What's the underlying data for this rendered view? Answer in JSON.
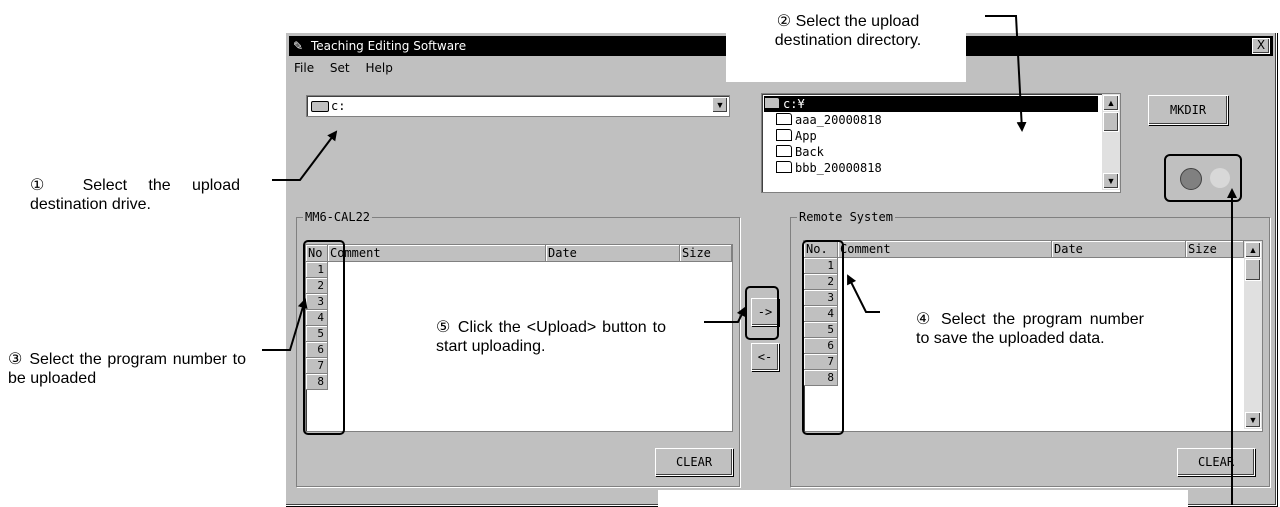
{
  "window": {
    "title": "Teaching Editing Software",
    "close_glyph": "X",
    "menu": [
      "File",
      "Set",
      "Help"
    ]
  },
  "drive": {
    "value": "c:"
  },
  "directory": {
    "items": [
      "c:¥",
      "aaa_20000818",
      "App",
      "Back",
      "bbb_20000818"
    ]
  },
  "buttons": {
    "mkdir": "MKDIR",
    "upload": "->",
    "download": "<-",
    "clear_left": "CLEAR",
    "clear_right": "CLEAR"
  },
  "left_panel": {
    "group_label": "MM6-CAL22",
    "columns": [
      "No",
      "Comment",
      "Date",
      "Size"
    ],
    "rows": [
      "1",
      "2",
      "3",
      "4",
      "5",
      "6",
      "7",
      "8"
    ]
  },
  "right_panel": {
    "group_label": "Remote System",
    "columns": [
      "No.",
      "Comment",
      "Date",
      "Size"
    ],
    "rows": [
      "1",
      "2",
      "3",
      "4",
      "5",
      "6",
      "7",
      "8"
    ]
  },
  "annotations": {
    "a1_mark": "①",
    "a1_text": "Select the upload destination drive.",
    "a2_mark": "②",
    "a2_text": "Select the upload destination directory.",
    "a3_mark": "③",
    "a3_text": "Select the program number to be uploaded",
    "a4_mark": "④",
    "a4_text": "Select the program number to save the uploaded data.",
    "a5_mark": "⑤",
    "a5_text": "Click the <Upload> button to start uploading."
  },
  "colors": {
    "lamp": "#808080",
    "lamp_off": "#d8d8d8",
    "face": "#c0c0c0"
  }
}
